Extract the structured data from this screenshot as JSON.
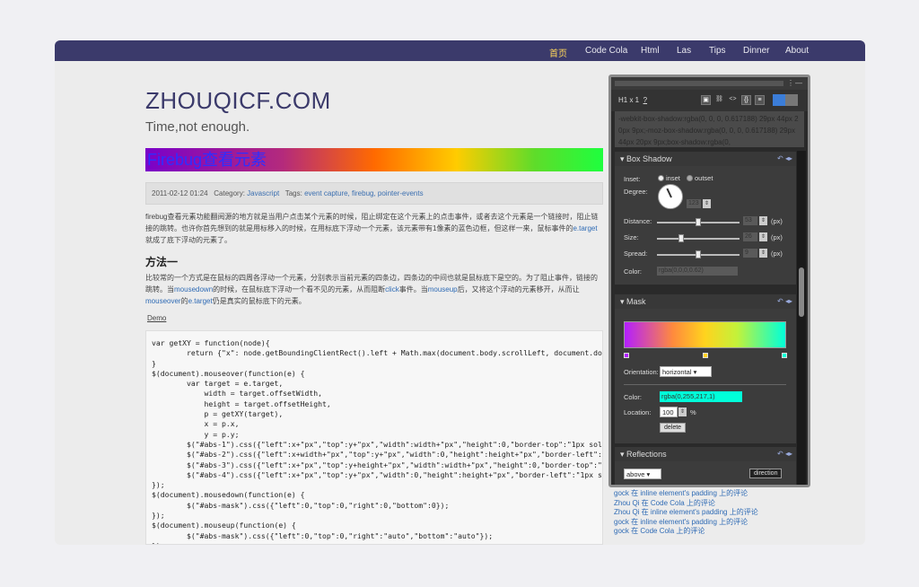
{
  "nav": {
    "items": [
      {
        "label": "首页",
        "active": true
      },
      {
        "label": "Code Cola",
        "active": false
      },
      {
        "label": "Html",
        "active": false
      },
      {
        "label": "Las",
        "active": false
      },
      {
        "label": "Tips",
        "active": false
      },
      {
        "label": "Dinner",
        "active": false
      },
      {
        "label": "About",
        "active": false
      }
    ]
  },
  "site": {
    "title": "ZHOUQICF.COM",
    "subtitle": "Time,not enough."
  },
  "post": {
    "title": "Firebug查看元素",
    "meta_date": "2011-02-12 01:24",
    "meta_category_label": "Category:",
    "meta_category": "Javascript",
    "meta_tags_label": "Tags:",
    "meta_tags": "event capture, firebug, pointer-events",
    "para1_text": "firebug查看元素功能翻阅源的地方就是当用户点击某个元素的时候，阻止绑定在这个元素上的点击事件，或者去这个元素是一个链接时，阻止链接的跳转。也许你首先想到的就是用标移入的时候，在用标底下浮动一个元素，该元素带有1像素的蓝色边框，但这样一来，鼠标事件的",
    "para1_link": "e.target",
    "para1_end": "就成了底下浮动的元素了。",
    "heading": "方法一",
    "para2_a": "比较常的一个方式是在鼠标的四周各浮动一个元素，分别表示当前元素的四条边，四条边的中间也就是鼠标底下是空的。为了阻止事件，链接的跳转。当",
    "para2_link1": "mousedown",
    "para2_b": "的时候，在鼠标底下浮动一个看不见的元素，从而阻断",
    "para2_link2": "click",
    "para2_c": "事件。当",
    "para2_link3": "mouseup",
    "para2_d": "后，又将这个浮动的元素移开，从而让",
    "para2_link4": "mouseover",
    "para2_e": "的",
    "para2_link5": "e.target",
    "para2_f": "仍是真实的鼠标底下的元素。",
    "demo_label": "Demo",
    "code": "var getXY = function(node){\n        return {\"x\": node.getBoundingClientRect().left + Math.max(document.body.scrollLeft, document.docum\n}\n$(document).mouseover(function(e) {\n        var target = e.target,\n            width = target.offsetWidth,\n            height = target.offsetHeight,\n            p = getXY(target),\n            x = p.x,\n            y = p.y;\n        $(\"#abs-1\").css({\"left\":x+\"px\",\"top\":y+\"px\",\"width\":width+\"px\",\"height\":0,\"border-top\":\"1px solid blue\"});\n        $(\"#abs-2\").css({\"left\":x+width+\"px\",\"top\":y+\"px\",\"width\":0,\"height\":height+\"px\",\"border-left\":\"1px solid b\n        $(\"#abs-3\").css({\"left\":x+\"px\",\"top\":y+height+\"px\",\"width\":width+\"px\",\"height\":0,\"border-top\":\"1px solid b\n        $(\"#abs-4\").css({\"left\":x+\"px\",\"top\":y+\"px\",\"width\":0,\"height\":height+\"px\",\"border-left\":\"1px solid blue\"});\n});\n$(document).mousedown(function(e) {\n        $(\"#abs-mask\").css({\"left\":0,\"top\":0,\"right\":0,\"bottom\":0});\n});\n$(document).mouseup(function(e) {\n        $(\"#abs-mask\").css({\"left\":0,\"top\":0,\"right\":\"auto\",\"bottom\":\"auto\"});\n});"
  },
  "comments": [
    "gock 在 inline element's padding 上的评论",
    "Zhou Qi 在 Code Cola 上的评论",
    "Zhou Qi 在 inline element's padding 上的评论",
    "gock 在 inline element's padding 上的评论",
    "gock 在 Code Cola 上的评论"
  ],
  "panel": {
    "selector": "H1 x 1",
    "help": "?",
    "toolbar_icons": [
      "image-icon",
      "link-icon",
      "code-icon",
      "bracket-icon",
      "list-icon"
    ],
    "toolbar_code_glyph": "<>",
    "toolbar_bracket_glyph": "{}",
    "css_output": "-webkit-box-shadow:rgba(0, 0, 0, 0.617188) 29px 44px 20px 9px;-moz-box-shadow:rgba(0, 0, 0, 0.617188) 29px 44px 20px 9px;box-shadow:rgba(0,",
    "box_shadow": {
      "title": "Box Shadow",
      "inset_label": "Inset:",
      "inset_opt": "inset",
      "outset_opt": "outset",
      "degree_label": "Degree:",
      "degree_value": "123",
      "distance_label": "Distance:",
      "distance_value": "53",
      "size_label": "Size:",
      "size_value": "26",
      "spread_label": "Spread:",
      "spread_value": "9",
      "unit": "(px)",
      "color_label": "Color:",
      "color_value": "rgba(0,0,0,0.62)",
      "distance_fraction": 0.5,
      "size_fraction": 0.28,
      "spread_fraction": 0.5
    },
    "mask": {
      "title": "Mask",
      "orientation_label": "Orientation:",
      "orientation_value": "horizontal",
      "color_label": "Color:",
      "color_value": "rgba(0,255,217,1)",
      "location_label": "Location:",
      "location_value": "100",
      "location_unit": "%",
      "delete_label": "delete"
    },
    "reflections": {
      "title": "Reflections",
      "select_value": "above",
      "direction_label": "direction"
    }
  }
}
